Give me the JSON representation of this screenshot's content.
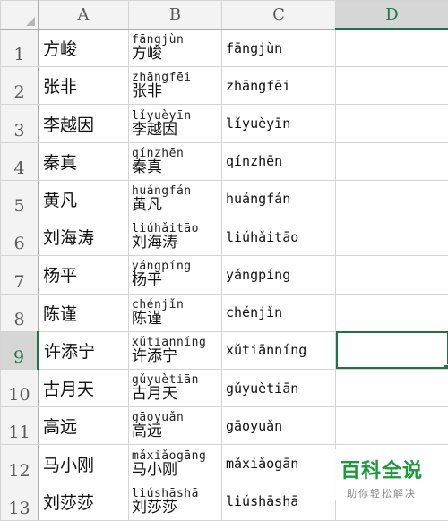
{
  "columns": [
    "A",
    "B",
    "C",
    "D"
  ],
  "active_cell": "D9",
  "rows": [
    {
      "num": "1",
      "a": "方峻",
      "b_pinyin": "fāngjùn",
      "b_hanzi": "方峻",
      "c": "fāngjùn"
    },
    {
      "num": "2",
      "a": "张非",
      "b_pinyin": "zhāngfēi",
      "b_hanzi": "张非",
      "c": "zhāngfēi"
    },
    {
      "num": "3",
      "a": "李越因",
      "b_pinyin": "lǐyuèyīn",
      "b_hanzi": "李越因",
      "c": "lǐyuèyīn"
    },
    {
      "num": "4",
      "a": "秦真",
      "b_pinyin": "qínzhēn",
      "b_hanzi": "秦真",
      "c": "qínzhēn"
    },
    {
      "num": "5",
      "a": "黄凡",
      "b_pinyin": "huángfán",
      "b_hanzi": "黄凡",
      "c": "huángfán"
    },
    {
      "num": "6",
      "a": "刘海涛",
      "b_pinyin": "liúhǎitāo",
      "b_hanzi": "刘海涛",
      "c": "liúhǎitāo"
    },
    {
      "num": "7",
      "a": "杨平",
      "b_pinyin": "yángpíng",
      "b_hanzi": "杨平",
      "c": "yángpíng"
    },
    {
      "num": "8",
      "a": "陈谨",
      "b_pinyin": "chénjǐn",
      "b_hanzi": "陈谨",
      "c": "chénjǐn"
    },
    {
      "num": "9",
      "a": "许添宁",
      "b_pinyin": "xǔtiānníng",
      "b_hanzi": "许添宁",
      "c": "xǔtiānníng"
    },
    {
      "num": "10",
      "a": "古月天",
      "b_pinyin": "gǔyuètiān",
      "b_hanzi": "古月天",
      "c": "gǔyuètiān"
    },
    {
      "num": "11",
      "a": "高远",
      "b_pinyin": "gāoyuǎn",
      "b_hanzi": "高远",
      "c": "gāoyuǎn"
    },
    {
      "num": "12",
      "a": "马小刚",
      "b_pinyin": "mǎxiǎogāng",
      "b_hanzi": "马小刚",
      "c": "mǎxiǎogān"
    },
    {
      "num": "13",
      "a": "刘莎莎",
      "b_pinyin": "liúshāshā",
      "b_hanzi": "刘莎莎",
      "c": "liúshāshā"
    }
  ],
  "watermark": {
    "brand": "百科全说",
    "slogan": "助你轻松解决"
  },
  "colors": {
    "accent": "#217346",
    "brand": "#1a9a3a"
  }
}
